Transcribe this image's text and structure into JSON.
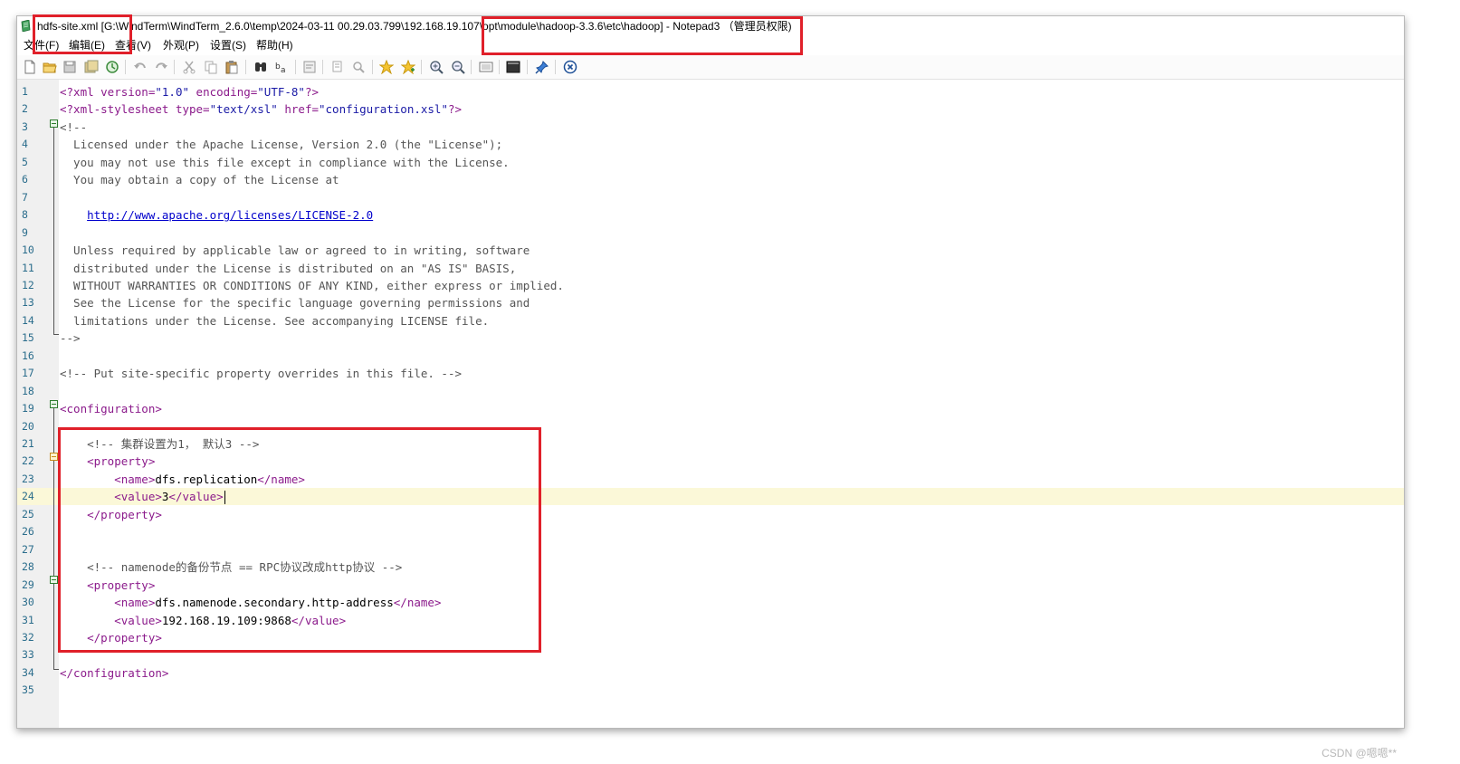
{
  "window": {
    "title": "hdfs-site.xml [G:\\WindTerm\\WindTerm_2.6.0\\temp\\2024-03-11 00.29.03.799\\192.168.19.107\\opt\\module\\hadoop-3.3.6\\etc\\hadoop] - Notepad3  （管理员权限)"
  },
  "menu": [
    "文件(F)",
    "编辑(E)",
    "查看(V)",
    "外观(P)",
    "设置(S)",
    "帮助(H)"
  ],
  "toolbar": {
    "icons": [
      "new-file-icon",
      "open-folder-icon",
      "save-icon",
      "save-as-icon",
      "revert-icon",
      "undo-icon",
      "redo-icon",
      "cut-icon",
      "copy-icon",
      "paste-icon",
      "find-icon",
      "replace-icon",
      "wordwrap-icon",
      "zoom-fit-icon",
      "search-zoom-icon",
      "favorite-icon",
      "add-favorite-icon",
      "zoom-in-icon",
      "zoom-out-icon",
      "settings-panel-icon",
      "terminal-icon",
      "pin-icon",
      "close-circle-icon"
    ]
  },
  "editor": {
    "current_line": 24,
    "lines": [
      {
        "n": "1",
        "segments": [
          [
            "pi",
            "<?xml "
          ],
          [
            "attr",
            "version="
          ],
          [
            "val",
            "\"1.0\""
          ],
          [
            "attr",
            " encoding="
          ],
          [
            "val",
            "\"UTF-8\""
          ],
          [
            "pi",
            "?>"
          ]
        ]
      },
      {
        "n": "2",
        "segments": [
          [
            "pi",
            "<?xml-stylesheet "
          ],
          [
            "attr",
            "type="
          ],
          [
            "val",
            "\"text/xsl\""
          ],
          [
            "attr",
            " href="
          ],
          [
            "val",
            "\"configuration.xsl\""
          ],
          [
            "pi",
            "?>"
          ]
        ]
      },
      {
        "n": "3",
        "segments": [
          [
            "comment",
            "<!--"
          ]
        ]
      },
      {
        "n": "4",
        "segments": [
          [
            "comment",
            "  Licensed under the Apache License, Version 2.0 (the \"License\");"
          ]
        ]
      },
      {
        "n": "5",
        "segments": [
          [
            "comment",
            "  you may not use this file except in compliance with the License."
          ]
        ]
      },
      {
        "n": "6",
        "segments": [
          [
            "comment",
            "  You may obtain a copy of the License at"
          ]
        ]
      },
      {
        "n": "7",
        "segments": []
      },
      {
        "n": "8",
        "segments": [
          [
            "comment",
            "    "
          ],
          [
            "link",
            "http://www.apache.org/licenses/LICENSE-2.0"
          ]
        ]
      },
      {
        "n": "9",
        "segments": []
      },
      {
        "n": "10",
        "segments": [
          [
            "comment",
            "  Unless required by applicable law or agreed to in writing, software"
          ]
        ]
      },
      {
        "n": "11",
        "segments": [
          [
            "comment",
            "  distributed under the License is distributed on an \"AS IS\" BASIS,"
          ]
        ]
      },
      {
        "n": "12",
        "segments": [
          [
            "comment",
            "  WITHOUT WARRANTIES OR CONDITIONS OF ANY KIND, either express or implied."
          ]
        ]
      },
      {
        "n": "13",
        "segments": [
          [
            "comment",
            "  See the License for the specific language governing permissions and"
          ]
        ]
      },
      {
        "n": "14",
        "segments": [
          [
            "comment",
            "  limitations under the License. See accompanying LICENSE file."
          ]
        ]
      },
      {
        "n": "15",
        "segments": [
          [
            "comment",
            "-->"
          ]
        ]
      },
      {
        "n": "16",
        "segments": []
      },
      {
        "n": "17",
        "segments": [
          [
            "comment",
            "<!-- Put site-specific property overrides in this file. -->"
          ]
        ]
      },
      {
        "n": "18",
        "segments": []
      },
      {
        "n": "19",
        "segments": [
          [
            "tag",
            "<configuration>"
          ]
        ]
      },
      {
        "n": "20",
        "segments": []
      },
      {
        "n": "21",
        "segments": [
          [
            "comment",
            "    <!-- 集群设置为1， 默认3 -->"
          ]
        ]
      },
      {
        "n": "22",
        "segments": [
          [
            "tag",
            "    <property>"
          ]
        ]
      },
      {
        "n": "23",
        "segments": [
          [
            "tag",
            "        <name>"
          ],
          [
            "text",
            "dfs.replication"
          ],
          [
            "tag",
            "</name>"
          ]
        ]
      },
      {
        "n": "24",
        "segments": [
          [
            "tag",
            "        <value>"
          ],
          [
            "text",
            "3"
          ],
          [
            "tag",
            "</value>"
          ]
        ]
      },
      {
        "n": "25",
        "segments": [
          [
            "tag",
            "    </property>"
          ]
        ]
      },
      {
        "n": "26",
        "segments": []
      },
      {
        "n": "27",
        "segments": []
      },
      {
        "n": "28",
        "segments": [
          [
            "comment",
            "    <!-- namenode的备份节点 == RPC协议改成http协议 -->"
          ]
        ]
      },
      {
        "n": "29",
        "segments": [
          [
            "tag",
            "    <property>"
          ]
        ]
      },
      {
        "n": "30",
        "segments": [
          [
            "tag",
            "        <name>"
          ],
          [
            "text",
            "dfs.namenode.secondary.http-address"
          ],
          [
            "tag",
            "</name>"
          ]
        ]
      },
      {
        "n": "31",
        "segments": [
          [
            "tag",
            "        <value>"
          ],
          [
            "text",
            "192.168.19.109:9868"
          ],
          [
            "tag",
            "</value>"
          ]
        ]
      },
      {
        "n": "32",
        "segments": [
          [
            "tag",
            "    </property>"
          ]
        ]
      },
      {
        "n": "33",
        "segments": []
      },
      {
        "n": "34",
        "segments": [
          [
            "tag",
            "</configuration>"
          ]
        ]
      },
      {
        "n": "35",
        "segments": []
      }
    ]
  },
  "watermark": "CSDN @嗯嗯**"
}
